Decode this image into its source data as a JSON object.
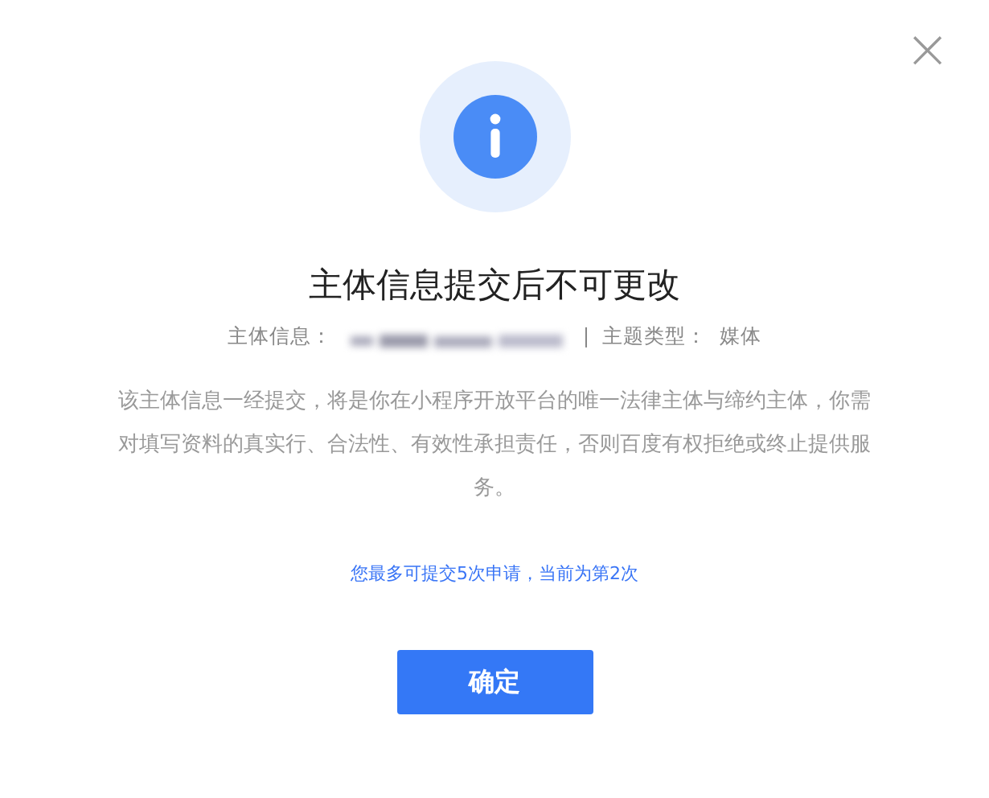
{
  "dialog": {
    "close": "×",
    "title": "主体信息提交后不可更改",
    "subject_label": "主体信息：",
    "subject_redacted": true,
    "separator": "|",
    "type_label": "主题类型：",
    "type_value": "媒体",
    "description": "该主体信息一经提交，将是你在小程序开放平台的唯一法律主体与缔约主体，你需对填写资料的真实行、合法性、有效性承担责任，否则百度有权拒绝或终止提供服务。",
    "note": "您最多可提交5次申请，当前为第2次",
    "confirm_button": "确定"
  }
}
